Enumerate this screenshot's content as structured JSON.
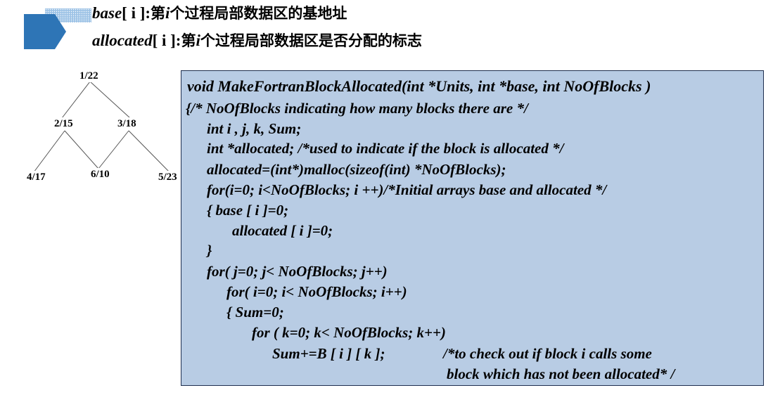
{
  "heading": {
    "line1": {
      "keyword": "base",
      "bracket": "[ i ]:",
      "text_before": "第",
      "ivar": "i",
      "text_after": "个过程局部数据区的基地址"
    },
    "line2": {
      "keyword": "allocated",
      "bracket": "[ i ]:",
      "text_before": "第",
      "ivar": "i",
      "text_after": "个过程局部数据区是否分配的标志"
    }
  },
  "tree": {
    "nodes": [
      {
        "id": "root",
        "label": "1/22"
      },
      {
        "id": "n2",
        "label": "2/15"
      },
      {
        "id": "n3",
        "label": "3/18"
      },
      {
        "id": "n4",
        "label": "4/17"
      },
      {
        "id": "n6",
        "label": "6/10"
      },
      {
        "id": "n5",
        "label": "5/23"
      }
    ]
  },
  "code": {
    "lines": [
      "void  MakeFortranBlockAllocated(int *Units, int *base,  int  NoOfBlocks )",
      "{/* NoOfBlocks  indicating  how  many  blocks  there  are */",
      "int  i , j, k, Sum;",
      "int *allocated; /*used  to  indicate  if  the  block  is  allocated */",
      "allocated=(int*)malloc(sizeof(int) *NoOfBlocks);",
      "for(i=0; i<NoOfBlocks;  i ++)/*Initial  arrays  base  and  allocated */",
      "{     base [ i ]=0;",
      "allocated [ i ]=0;",
      "}",
      "for( j=0; j< NoOfBlocks; j++)",
      "for( i=0; i< NoOfBlocks; i++)",
      "{    Sum=0;",
      "for ( k=0; k< NoOfBlocks; k++)",
      "Sum+=B [ i ] [ k ];",
      "/*to  check  out  if  block  i  calls  some",
      "block which  has  not  been  allocated* /"
    ]
  },
  "colors": {
    "bullet": "#2e75b6",
    "code_background": "#b8cce4",
    "code_border": "#1f2f4f"
  }
}
